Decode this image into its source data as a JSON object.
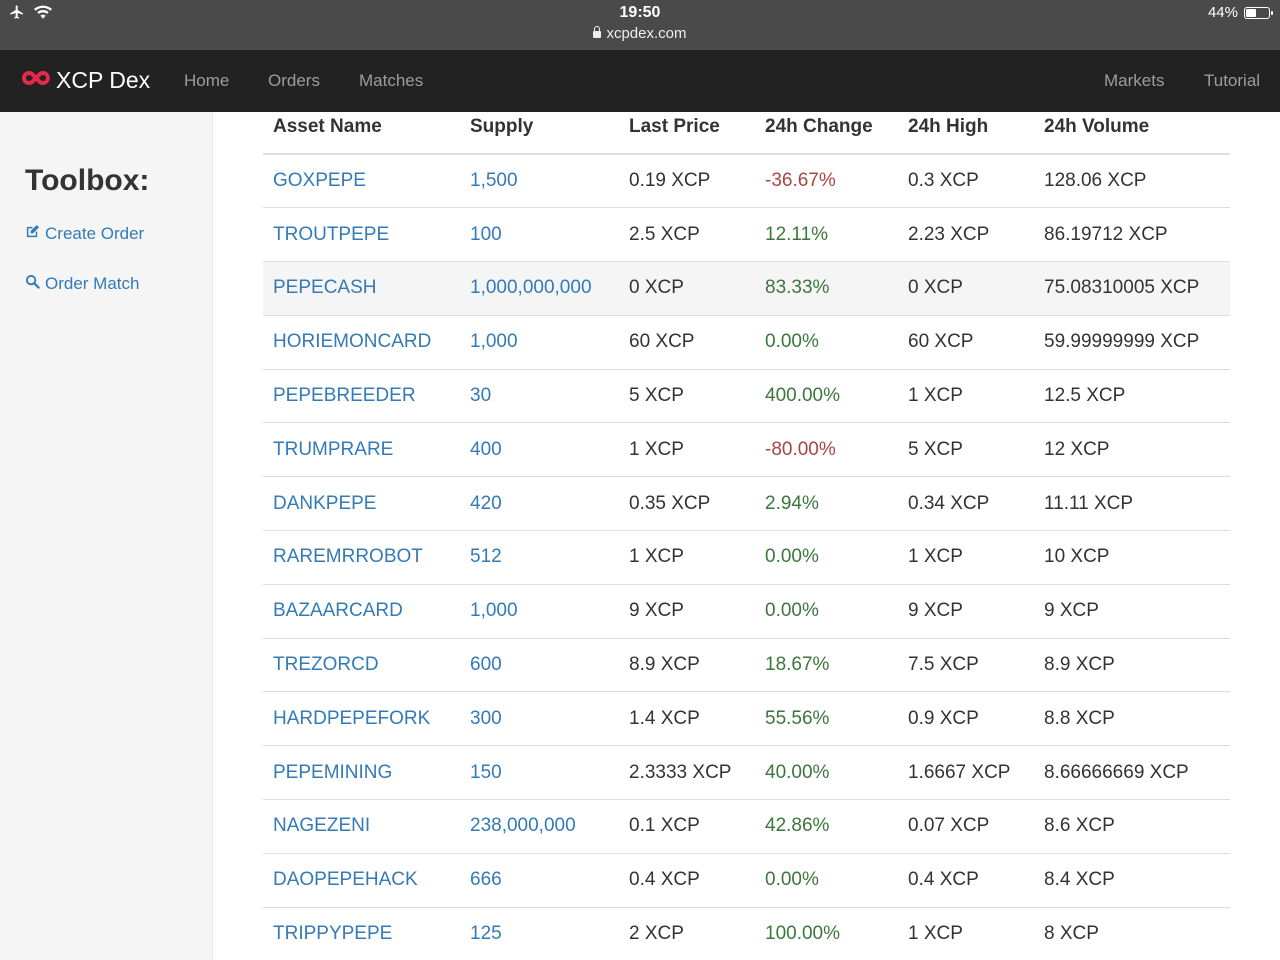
{
  "status": {
    "time": "19:50",
    "battery": "44%",
    "battery_fraction": 0.44,
    "url": "xcpdex.com"
  },
  "nav": {
    "brand": "XCP Dex",
    "links": [
      "Home",
      "Orders",
      "Matches"
    ],
    "right_links": [
      "Markets",
      "Tutorial"
    ]
  },
  "sidebar": {
    "title": "Toolbox:",
    "create_order": "Create Order",
    "order_match": "Order Match"
  },
  "table": {
    "headers": [
      "Asset Name",
      "Supply",
      "Last Price",
      "24h Change",
      "24h High",
      "24h Volume"
    ],
    "rows": [
      {
        "asset": "GOXPEPE",
        "supply": "1,500",
        "last": "0.19 XCP",
        "change": "-36.67%",
        "trend": "neg",
        "high": "0.3 XCP",
        "volume": "128.06 XCP"
      },
      {
        "asset": "TROUTPEPE",
        "supply": "100",
        "last": "2.5 XCP",
        "change": "12.11%",
        "trend": "pos",
        "high": "2.23 XCP",
        "volume": "86.19712 XCP"
      },
      {
        "asset": "PEPECASH",
        "supply": "1,000,000,000",
        "last": "0 XCP",
        "change": "83.33%",
        "trend": "pos",
        "high": "0 XCP",
        "volume": "75.08310005 XCP"
      },
      {
        "asset": "HORIEMONCARD",
        "supply": "1,000",
        "last": "60 XCP",
        "change": "0.00%",
        "trend": "pos",
        "high": "60 XCP",
        "volume": "59.99999999 XCP"
      },
      {
        "asset": "PEPEBREEDER",
        "supply": "30",
        "last": "5 XCP",
        "change": "400.00%",
        "trend": "pos",
        "high": "1 XCP",
        "volume": "12.5 XCP"
      },
      {
        "asset": "TRUMPRARE",
        "supply": "400",
        "last": "1 XCP",
        "change": "-80.00%",
        "trend": "neg",
        "high": "5 XCP",
        "volume": "12 XCP"
      },
      {
        "asset": "DANKPEPE",
        "supply": "420",
        "last": "0.35 XCP",
        "change": "2.94%",
        "trend": "pos",
        "high": "0.34 XCP",
        "volume": "11.11 XCP"
      },
      {
        "asset": "RAREMRROBOT",
        "supply": "512",
        "last": "1 XCP",
        "change": "0.00%",
        "trend": "pos",
        "high": "1 XCP",
        "volume": "10 XCP"
      },
      {
        "asset": "BAZAARCARD",
        "supply": "1,000",
        "last": "9 XCP",
        "change": "0.00%",
        "trend": "pos",
        "high": "9 XCP",
        "volume": "9 XCP"
      },
      {
        "asset": "TREZORCD",
        "supply": "600",
        "last": "8.9 XCP",
        "change": "18.67%",
        "trend": "pos",
        "high": "7.5 XCP",
        "volume": "8.9 XCP"
      },
      {
        "asset": "HARDPEPEFORK",
        "supply": "300",
        "last": "1.4 XCP",
        "change": "55.56%",
        "trend": "pos",
        "high": "0.9 XCP",
        "volume": "8.8 XCP"
      },
      {
        "asset": "PEPEMINING",
        "supply": "150",
        "last": "2.3333 XCP",
        "change": "40.00%",
        "trend": "pos",
        "high": "1.6667 XCP",
        "volume": "8.66666669 XCP"
      },
      {
        "asset": "NAGEZENI",
        "supply": "238,000,000",
        "last": "0.1 XCP",
        "change": "42.86%",
        "trend": "pos",
        "high": "0.07 XCP",
        "volume": "8.6 XCP"
      },
      {
        "asset": "DAOPEPEHACK",
        "supply": "666",
        "last": "0.4 XCP",
        "change": "0.00%",
        "trend": "pos",
        "high": "0.4 XCP",
        "volume": "8.4 XCP"
      },
      {
        "asset": "TRIPPYPEPE",
        "supply": "125",
        "last": "2 XCP",
        "change": "100.00%",
        "trend": "pos",
        "high": "1 XCP",
        "volume": "8 XCP"
      }
    ]
  },
  "colors": {
    "link": "#337ab7",
    "negative": "#a94442",
    "positive": "#3c763d",
    "navbar": "#222222",
    "brand_logo": "#e8284a"
  },
  "icons": [
    "airplane-icon",
    "wifi-icon",
    "lock-icon",
    "battery-icon",
    "xcp-logo-icon",
    "edit-icon",
    "search-icon"
  ]
}
